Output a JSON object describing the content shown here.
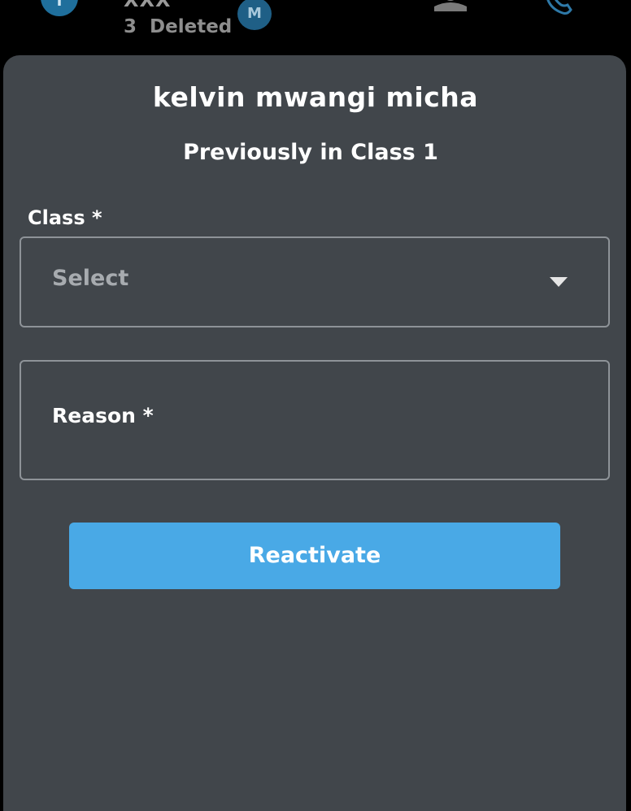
{
  "background_row": {
    "avatar_letter": "T",
    "name": "XXX",
    "status_count": "3",
    "status_text": "Deleted",
    "badge_letter": "M"
  },
  "sheet": {
    "title": "kelvin mwangi micha",
    "subtitle": "Previously in Class 1",
    "class_label": "Class *",
    "class_select": {
      "value": "Select"
    },
    "reason_label": "Reason *",
    "reactivate_label": "Reactivate"
  },
  "colors": {
    "sheet_background": "#41464b",
    "accent_button": "#49a9e6",
    "field_border": "#8e9398",
    "screen_background": "#000000"
  },
  "icons": {
    "caret": "chevron-down-icon",
    "person": "person-icon",
    "phone": "phone-icon"
  }
}
